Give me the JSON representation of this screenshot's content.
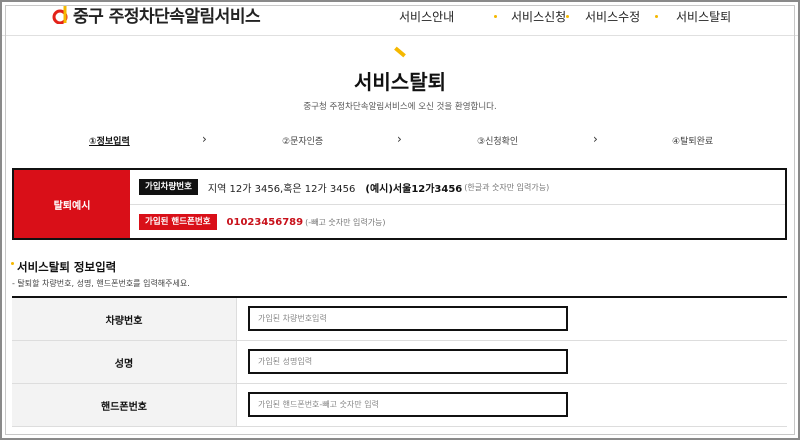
{
  "header": {
    "logo_mark_text": "d",
    "logo_text": "중구 주정차단속알림서비스",
    "nav": [
      "서비스안내",
      "서비스신청",
      "서비스수정",
      "서비스탈퇴"
    ]
  },
  "page": {
    "title": "서비스탈퇴",
    "subtitle": "중구청 주정차단속알림서비스에 오신 것을 환영합니다."
  },
  "steps": [
    "①정보입력",
    "②문자인증",
    "③신청확인",
    "④탈퇴완료"
  ],
  "example": {
    "label": "탈퇴예시",
    "plate_badge": "가입차량번호",
    "plate_text": "지역 12가 3456,혹은 12가 3456",
    "plate_example": "(예시)서울12가3456",
    "plate_note": "(한글과 숫자만 입력가능)",
    "phone_badge": "가입된 핸드폰번호",
    "phone_example": "01023456789",
    "phone_note": "(-빼고 숫자만 입력가능)"
  },
  "section": {
    "title": "서비스탈퇴 정보입력",
    "desc": "- 탈퇴할 차량번호, 성명, 핸드폰번호를 입력해주세요."
  },
  "form": {
    "plate_label": "차량번호",
    "plate_placeholder": "가입된 차량번호입력",
    "name_label": "성명",
    "name_placeholder": "가입된 성명입력",
    "phone_label": "핸드폰번호",
    "phone_placeholder": "가입된 핸드폰번호-빼고 숫자만 입력"
  },
  "colors": {
    "accent": "#f5b800",
    "red": "#d90f18",
    "dark": "#111111"
  }
}
